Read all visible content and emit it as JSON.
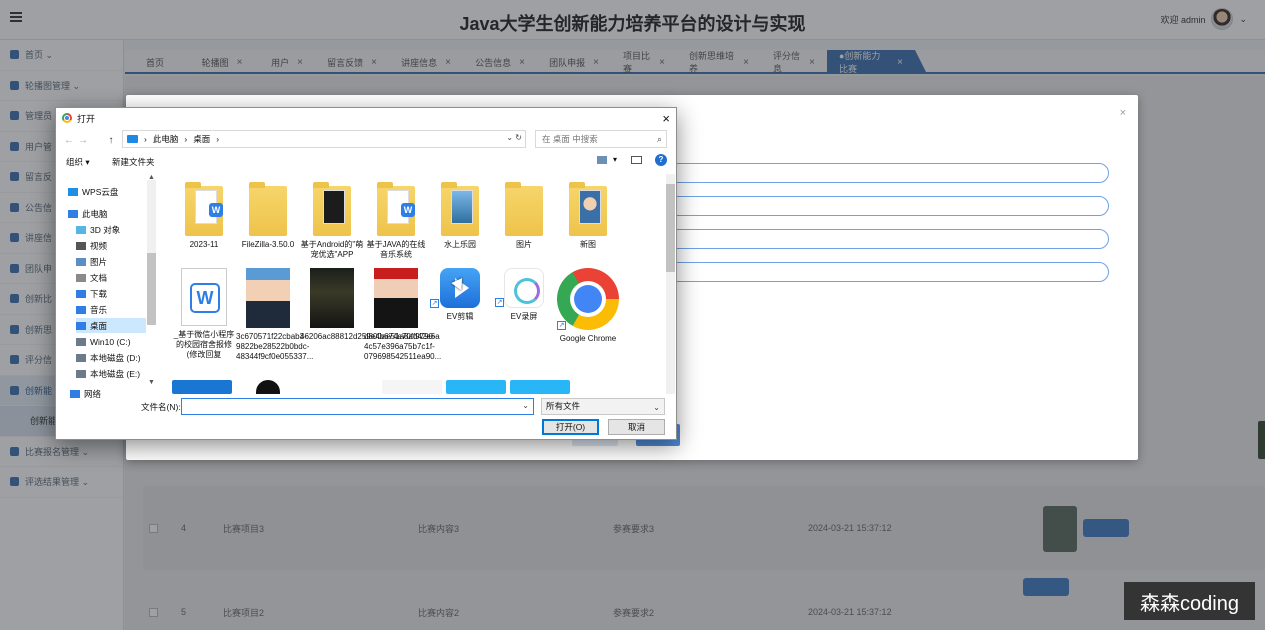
{
  "app": {
    "title": "Java大学生创新能力培养平台的设计与实现",
    "user_label": "欢迎 admin"
  },
  "sidebar": {
    "items": [
      {
        "label": "首页 ⌄"
      },
      {
        "label": "轮播图管理 ⌄"
      },
      {
        "label": "管理员"
      },
      {
        "label": "用户管"
      },
      {
        "label": "留言反"
      },
      {
        "label": "公告信"
      },
      {
        "label": "讲座信"
      },
      {
        "label": "团队申"
      },
      {
        "label": "创新比"
      },
      {
        "label": "创新思"
      },
      {
        "label": "评分信"
      },
      {
        "label": "创新能"
      },
      {
        "label": "创新能"
      },
      {
        "label": "比赛报名管理 ⌄"
      },
      {
        "label": "评选结果管理 ⌄"
      }
    ]
  },
  "tabs": [
    {
      "label": "首页"
    },
    {
      "label": "轮播图"
    },
    {
      "label": "用户"
    },
    {
      "label": "留言反馈"
    },
    {
      "label": "讲座信息"
    },
    {
      "label": "公告信息"
    },
    {
      "label": "团队申报"
    },
    {
      "label": "项目比赛"
    },
    {
      "label": "创新思维培养"
    },
    {
      "label": "评分信息"
    },
    {
      "label": "●创新能力比赛"
    }
  ],
  "tab_close": "×",
  "table": {
    "rows": [
      {
        "index": "4",
        "name": "比赛项目3",
        "content": "比赛内容3",
        "req": "参赛要求3",
        "time": "2024-03-21 15:37:12"
      },
      {
        "index": "5",
        "name": "比赛项目2",
        "content": "比赛内容2",
        "req": "参赛要求2",
        "time": "2024-03-21 15:37:12"
      }
    ]
  },
  "modal": {
    "close": "×"
  },
  "dialog": {
    "title": "打开",
    "close": "×",
    "nav_back": "←",
    "nav_forward": "→",
    "nav_up": "↑",
    "breadcrumb": [
      "此电脑",
      "桌面"
    ],
    "sep": "›",
    "addr_tail": "⌄  ↻",
    "search_placeholder": "在 桌面 中搜索",
    "search_icon": "⌕",
    "organize": "组织 ▾",
    "new_folder": "新建文件夹",
    "view_drop": "▾",
    "help": "?",
    "nav_items": [
      {
        "label": "WPS云盘",
        "icon": "cloud-icon",
        "color": "#1f8fe5"
      },
      {
        "label": "此电脑",
        "icon": "computer-icon",
        "color": "#2f7ee5"
      },
      {
        "label": "3D 对象",
        "icon": "3d-objects-icon",
        "color": "#57b5e6"
      },
      {
        "label": "视频",
        "icon": "video-icon",
        "color": "#555555"
      },
      {
        "label": "图片",
        "icon": "pictures-icon",
        "color": "#5b8ec4"
      },
      {
        "label": "文档",
        "icon": "documents-icon",
        "color": "#8a8a8a"
      },
      {
        "label": "下载",
        "icon": "download-icon",
        "color": "#2f7ee5"
      },
      {
        "label": "音乐",
        "icon": "music-icon",
        "color": "#2f7ee5"
      },
      {
        "label": "桌面",
        "icon": "desktop-icon",
        "color": "#2f7ee5"
      },
      {
        "label": "Win10 (C:)",
        "icon": "drive-icon",
        "color": "#6c7a89"
      },
      {
        "label": "本地磁盘 (D:)",
        "icon": "drive-icon",
        "color": "#6c7a89"
      },
      {
        "label": "本地磁盘 (E:)",
        "icon": "drive-icon",
        "color": "#6c7a89"
      },
      {
        "label": "网络",
        "icon": "network-icon",
        "color": "#2f7ee5"
      }
    ],
    "files": [
      {
        "label": "2023-11",
        "kind": "folder-wps"
      },
      {
        "label": "FileZilla-3.50.0",
        "kind": "folder"
      },
      {
        "label": "基于Android的\"萌宠优选\"APP",
        "kind": "folder-dark"
      },
      {
        "label": "基于JAVA的在线音乐系统",
        "kind": "folder-wps"
      },
      {
        "label": "水上乐园",
        "kind": "folder-photo"
      },
      {
        "label": "图片",
        "kind": "folder"
      },
      {
        "label": "新图",
        "kind": "folder-person"
      },
      {
        "label": "_基于微信小程序的校园宿舍报修(修改回复",
        "kind": "wps-doc"
      },
      {
        "label": "3c670571f22cbab3-9822be28522b0bdc-48344f9cf0e055337...",
        "kind": "photo-man"
      },
      {
        "label": "46206ac88812d259e4b674e70fd42e6a",
        "kind": "photo-night"
      },
      {
        "label": "d800ae51a8af9790-4c57e396a75b7c1f-079698542511ea90...",
        "kind": "photo-woman"
      },
      {
        "label": "EV剪辑",
        "kind": "ev-play"
      },
      {
        "label": "EV录屏",
        "kind": "ev-rec"
      },
      {
        "label": "Google Chrome",
        "kind": "chrome"
      }
    ],
    "filename_label": "文件名(N):",
    "filename_value": "",
    "filetype": "所有文件",
    "caret": "⌄",
    "open_btn": "打开(O)",
    "cancel_btn": "取消"
  },
  "watermark": "森森coding"
}
